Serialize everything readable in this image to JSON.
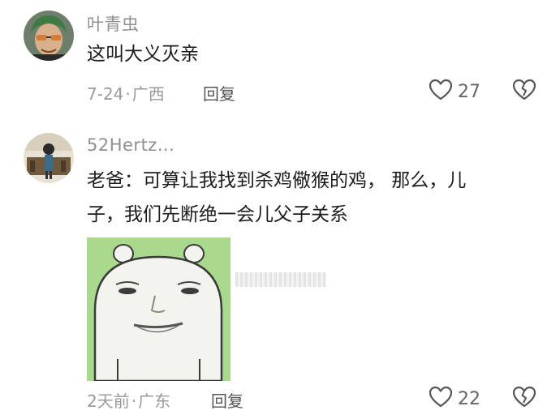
{
  "comments": [
    {
      "username": "叶青虫",
      "text_lines": [
        "这叫大义灭亲"
      ],
      "date": "7-24",
      "location": "广西",
      "reply_label": "回复",
      "like_count": "27"
    },
    {
      "username": "52Hertz...",
      "text_lines": [
        "老爸：可算让我找到杀鸡儆猴的鸡， 那么，儿",
        "子，我们先断绝一会儿父子关系"
      ],
      "date": "2天前",
      "location": "广东",
      "reply_label": "回复",
      "like_count": "22"
    }
  ],
  "separator": "·",
  "icons": {
    "like": "heart-outline-icon",
    "dislike": "broken-heart-icon"
  },
  "colors": {
    "username": "#8f8f8f",
    "meta": "#9a9a9a",
    "sticker_bg": "#a9d98c"
  }
}
